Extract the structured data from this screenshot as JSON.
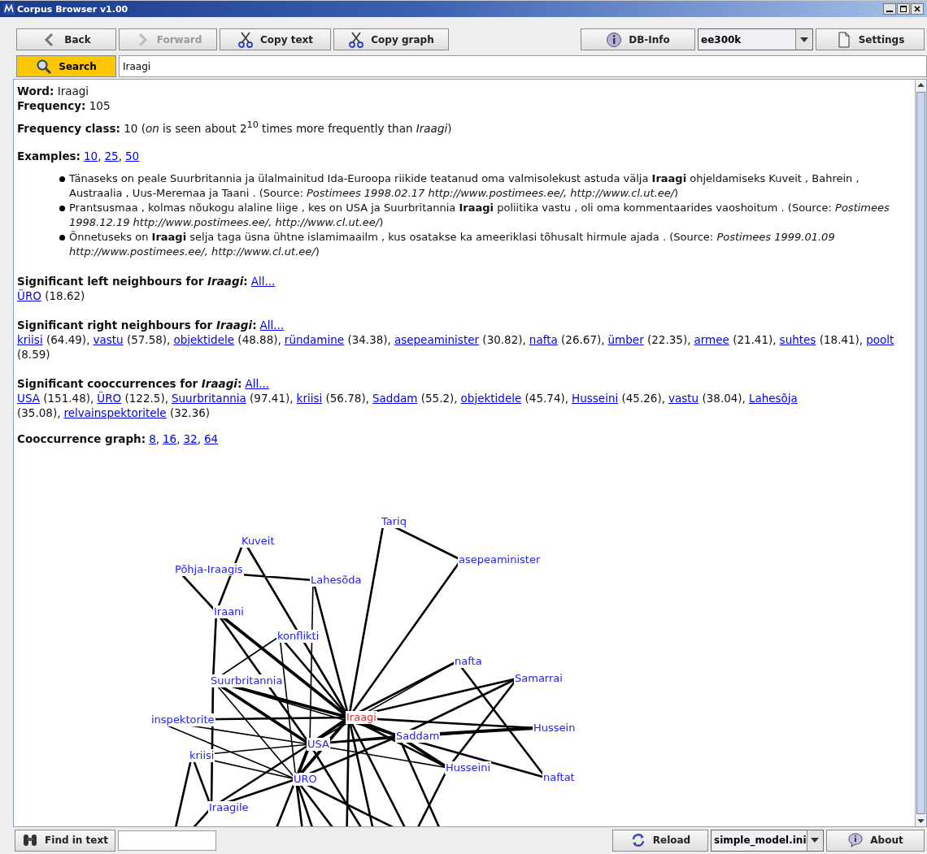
{
  "window": {
    "title": "Corpus Browser v1.00"
  },
  "toolbar": [
    {
      "kind": "button",
      "label": "Back",
      "disabled": false
    },
    {
      "kind": "button",
      "label": "Forward",
      "disabled": true
    },
    {
      "kind": "button",
      "label": "Copy text",
      "disabled": false
    },
    {
      "kind": "button",
      "label": "Copy graph",
      "disabled": false
    },
    {
      "kind": "spacer"
    },
    {
      "kind": "button",
      "label": "DB-Info",
      "disabled": false
    },
    {
      "kind": "dropdown",
      "value": "ee300k"
    },
    {
      "kind": "button",
      "label": "Settings",
      "disabled": false
    }
  ],
  "search": {
    "button": "Search",
    "highlighted": true,
    "value": "Iraagi"
  },
  "content": {
    "info": [
      "**Word:** Iraagi",
      "**Frequency:** 105"
    ],
    "frequency_class": "**Frequency class:** 10 (*on* is seen about 2$^{10}$ times more frequently than *Iraagi*)",
    "examples": {
      "label": "Examples:",
      "links": [
        {
          "text": "10",
          "after": ","
        },
        {
          "text": "25",
          "after": ","
        },
        {
          "text": "50"
        }
      ],
      "items": [
        "Tänaseks on peale Suurbritannia ja ülalmainitud Ida-Euroopa riikide teatanud oma valmisolekust astuda välja **Iraagi** ohjeldamiseks Kuveit , Bahrein , Austraalia , Uus-Meremaa ja Taani . (Source: *Postimees 1998.02.17 http://www.postimees.ee/, http://www.cl.ut.ee/*)",
        "Prantsusmaa , kolmas nõukogu alaline liige , kes on USA ja Suurbritannia **Iraagi** poliitika vastu , oli oma kommentaarides vaoshoitum . (Source: *Postimees 1998.12.19 http://www.postimees.ee/, http://www.cl.ut.ee/*)",
        "Õnnetuseks on **Iraagi** selja taga üsna ühtne islamimaailm , kus osatakse ka ameeriklasi tõhusalt hirmule ajada . (Source: *Postimees 1999.01.09 http://www.postimees.ee/, http://www.cl.ut.ee/*)"
      ]
    },
    "sections": [
      {
        "heading": "Significant left neighbours for *Iraagi*:",
        "link": "All...",
        "items": [
          {
            "word": "ÜRO",
            "rest": "(18.62)"
          }
        ]
      },
      {
        "heading": "Significant right neighbours for *Iraagi*:",
        "link": "All...",
        "items": [
          {
            "word": "kriisi",
            "rest": "(64.49),"
          },
          {
            "word": "vastu",
            "rest": "(57.58),"
          },
          {
            "word": "objektidele",
            "rest": "(48.88),"
          },
          {
            "word": "ründamine",
            "rest": "(34.38),"
          },
          {
            "word": "asepeaminister",
            "rest": "(30.82),"
          },
          {
            "word": "nafta",
            "rest": "(26.67),"
          },
          {
            "word": "ümber",
            "rest": "(22.35),"
          },
          {
            "word": "armee",
            "rest": "(21.41),"
          },
          {
            "word": "suhtes",
            "rest": "(18.41),"
          },
          {
            "word": "poolt",
            "rest": "(8.59)"
          }
        ]
      },
      {
        "heading": "Significant cooccurrences for *Iraagi*:",
        "link": "All...",
        "items": [
          {
            "word": "USA",
            "rest": "(151.48),"
          },
          {
            "word": "ÜRO",
            "rest": "(122.5),"
          },
          {
            "word": "Suurbritannia",
            "rest": "(97.41),"
          },
          {
            "word": "kriisi",
            "rest": "(56.78),"
          },
          {
            "word": "Saddam",
            "rest": "(55.2),"
          },
          {
            "word": "objektidele",
            "rest": "(45.74),"
          },
          {
            "word": "Husseini",
            "rest": "(45.26),"
          },
          {
            "word": "vastu",
            "rest": "(38.04),"
          },
          {
            "word": "Lahesõja",
            "rest": "(35.08),"
          },
          {
            "word": "relvainspektoritele",
            "rest": "(32.36)"
          }
        ]
      }
    ],
    "graph_links": {
      "label": "Cooccurrence graph:",
      "links": [
        {
          "text": "8",
          "after": ","
        },
        {
          "text": "16",
          "after": ","
        },
        {
          "text": "32",
          "after": ","
        },
        {
          "text": "64"
        }
      ]
    },
    "graph_nodes": [
      {
        "label": "Tariq",
        "kind": "word"
      },
      {
        "label": "asepeaminister",
        "kind": "word"
      },
      {
        "label": "Kuveit",
        "kind": "word"
      },
      {
        "label": "Põhja-Iraagis",
        "kind": "word"
      },
      {
        "label": "Lahesõda",
        "kind": "word"
      },
      {
        "label": "Iraani",
        "kind": "word"
      },
      {
        "label": "konflikti",
        "kind": "word"
      },
      {
        "label": "nafta",
        "kind": "word"
      },
      {
        "label": "Samarrai",
        "kind": "word"
      },
      {
        "label": "Suurbritannia",
        "kind": "word"
      },
      {
        "label": "inspektorite",
        "kind": "word"
      },
      {
        "label": "Iraagi",
        "kind": "center"
      },
      {
        "label": "Hussein",
        "kind": "word"
      },
      {
        "label": "Saddam",
        "kind": "word"
      },
      {
        "label": "USA",
        "kind": "word"
      },
      {
        "label": "kriisi",
        "kind": "word"
      },
      {
        "label": "Husseini",
        "kind": "word"
      },
      {
        "label": "naftat",
        "kind": "word"
      },
      {
        "label": "ÜRO",
        "kind": "word"
      },
      {
        "label": "Iraagile",
        "kind": "word"
      }
    ]
  },
  "bottom_bar": [
    {
      "kind": "button",
      "label": "Find in text"
    },
    {
      "kind": "field"
    },
    {
      "kind": "spacer"
    },
    {
      "kind": "button",
      "label": "Reload"
    },
    {
      "kind": "dropdown",
      "value": "simple_model.ini"
    },
    {
      "kind": "button",
      "label": "About"
    }
  ]
}
